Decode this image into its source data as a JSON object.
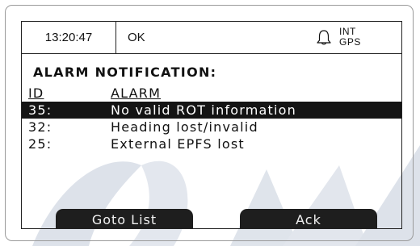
{
  "status_bar": {
    "time": "13:20:47",
    "status": "OK",
    "alarm_icon": "bell-icon",
    "position_source": [
      "INT",
      "GPS"
    ]
  },
  "panel": {
    "title": "ALARM NOTIFICATION:",
    "columns": {
      "id": "ID",
      "alarm": "ALARM"
    },
    "alarms": [
      {
        "id": "35:",
        "name": "No valid ROT information",
        "selected": true
      },
      {
        "id": "32:",
        "name": "Heading lost/invalid",
        "selected": false
      },
      {
        "id": "25:",
        "name": "External EPFS lost",
        "selected": false
      }
    ]
  },
  "softkeys": {
    "left": "Goto List",
    "right": "Ack"
  },
  "colors": {
    "selection_bg": "#141414",
    "softkey_bg": "#1e1e1e",
    "watermark": "#dde2ea"
  }
}
